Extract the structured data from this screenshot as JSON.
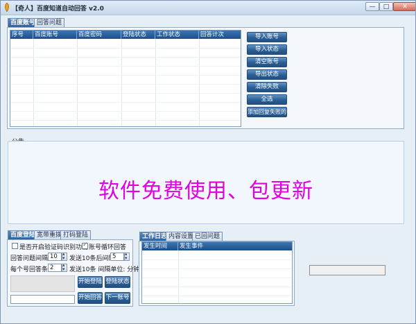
{
  "window": {
    "title": "【奇人】百度知道自动回答 v2.0",
    "controls": {
      "minimize": "—",
      "maximize": "□",
      "close": "✕"
    }
  },
  "top_tabs": [
    {
      "label": "百度账号",
      "active": true
    },
    {
      "label": "回答问题",
      "active": false
    }
  ],
  "accounts_table": {
    "columns": [
      "序号",
      "百度账号",
      "百度密码",
      "登陆状态",
      "工作状态",
      "回答计次"
    ],
    "rows": []
  },
  "account_buttons": {
    "import_accounts": "导入账号",
    "import_status": "导入状态",
    "clear_accounts": "清空账号",
    "export_status": "导出状态",
    "clear_failed": "清除失败",
    "select_all": "全选",
    "add_reply_failed": "添加回复失败的"
  },
  "notice": {
    "label": "公告",
    "text": "软件免费使用、包更新"
  },
  "bottom_left_tabs": [
    {
      "label": "百度登陆",
      "active": true
    },
    {
      "label": "宽带重拨",
      "active": false
    },
    {
      "label": "打码登陆",
      "active": false
    }
  ],
  "settings": {
    "enable_captcha_label": "是否开启验证码识别功能",
    "enable_captcha_checked": false,
    "loop_accounts_label": "账号循环回答",
    "loop_accounts_checked": true,
    "answer_interval_label": "回答问题间隔:",
    "answer_interval_value": "10",
    "after_ten_interval_label": "发送10条后间隔:",
    "after_ten_interval_value": "5",
    "per_account_label": "每个号回答条:",
    "per_account_value": "2",
    "unit_label": "发送10条 间隔单位: 分钟"
  },
  "action_buttons": {
    "start_login": "开始登陆",
    "login_status": "登陆状态",
    "start_answer": "开始回答",
    "next_account": "下一账号"
  },
  "log_tabs": [
    {
      "label": "工作日志",
      "active": true
    },
    {
      "label": "内容设置",
      "active": false
    },
    {
      "label": "已回问题",
      "active": false
    }
  ],
  "log_table": {
    "columns": [
      "发生时间",
      "发生事件"
    ],
    "rows": []
  }
}
